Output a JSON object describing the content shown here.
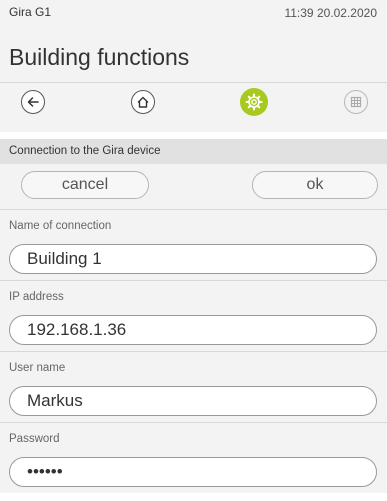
{
  "status": {
    "app_name": "Gira G1",
    "time_date": "11:39 20.02.2020"
  },
  "header": {
    "title": "Building functions"
  },
  "nav": {
    "back": "back-arrow-icon",
    "home": "home-icon",
    "settings": "gear-icon",
    "grid": "grid-icon",
    "active_color": "#a7c920"
  },
  "section": {
    "title": "Connection to the Gira device"
  },
  "actions": {
    "cancel_label": "cancel",
    "ok_label": "ok"
  },
  "fields": [
    {
      "label": "Name of connection",
      "value": "Building 1"
    },
    {
      "label": "IP address",
      "value": "192.168.1.36"
    },
    {
      "label": "User name",
      "value": "Markus"
    },
    {
      "label": "Password",
      "value": "••••••"
    }
  ]
}
